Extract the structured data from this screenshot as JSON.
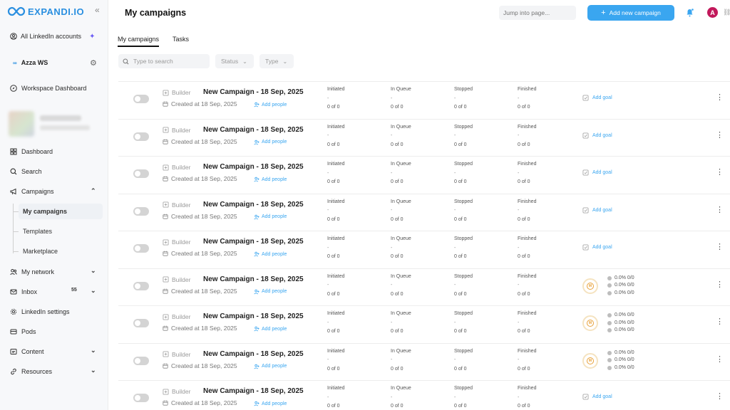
{
  "app": {
    "logo_text": "EXPANDI.IO"
  },
  "sidebar": {
    "accounts_label": "All LinkedIn accounts",
    "workspace_label": "Azza WS",
    "workspace_dashboard": "Workspace Dashboard",
    "items": [
      {
        "label": "Dashboard"
      },
      {
        "label": "Search"
      },
      {
        "label": "Campaigns"
      },
      {
        "label": "My network"
      },
      {
        "label": "Inbox",
        "badge": "55"
      },
      {
        "label": "LinkedIn settings"
      },
      {
        "label": "Pods"
      },
      {
        "label": "Content"
      },
      {
        "label": "Resources"
      }
    ],
    "campaign_sub": [
      {
        "label": "My campaigns"
      },
      {
        "label": "Templates"
      },
      {
        "label": "Marketplace"
      }
    ]
  },
  "header": {
    "title": "My campaigns",
    "jump_placeholder": "Jump into page...",
    "add_button": "Add new campaign",
    "avatar_letter": "A"
  },
  "tabs": [
    {
      "label": "My campaigns"
    },
    {
      "label": "Tasks"
    }
  ],
  "filters": {
    "search_placeholder": "Type to search",
    "status_label": "Status",
    "type_label": "Type"
  },
  "row_common": {
    "builder": "Builder",
    "add_people": "Add people",
    "add_goal": "Add goal",
    "stat_labels": [
      "Initiated",
      "In Queue",
      "Stopped",
      "Finished"
    ],
    "stat_dash": "-",
    "stat_count": "0 of 0",
    "pct_text": "0.0% 0/0"
  },
  "campaigns": [
    {
      "name": "New Campaign - 18 Sep, 2025",
      "created": "Created at 18 Sep, 2025",
      "goal": "add"
    },
    {
      "name": "New Campaign - 18 Sep, 2025",
      "created": "Created at 18 Sep, 2025",
      "goal": "add"
    },
    {
      "name": "New Campaign - 18 Sep, 2025",
      "created": "Created at 18 Sep, 2025",
      "goal": "add"
    },
    {
      "name": "New Campaign - 18 Sep, 2025",
      "created": "Created at 18 Sep, 2025",
      "goal": "add"
    },
    {
      "name": "New Campaign - 18 Sep, 2025",
      "created": "Created at 18 Sep, 2025",
      "goal": "add"
    },
    {
      "name": "New Campaign - 18 Sep, 2025",
      "created": "Created at 18 Sep, 2025",
      "goal": "set"
    },
    {
      "name": "New Campaign - 18 Sep, 2025",
      "created": "Created at 18 Sep, 2025",
      "goal": "set"
    },
    {
      "name": "New Campaign - 18 Sep, 2025",
      "created": "Created at 18 Sep, 2025",
      "goal": "set"
    },
    {
      "name": "New Campaign - 18 Sep, 2025",
      "created": "Created at 18 Sep, 2025",
      "goal": "add"
    }
  ],
  "colors": {
    "accent": "#3aa6f0",
    "avatar": "#c2185b",
    "goal_ring": "#e8a23a"
  }
}
